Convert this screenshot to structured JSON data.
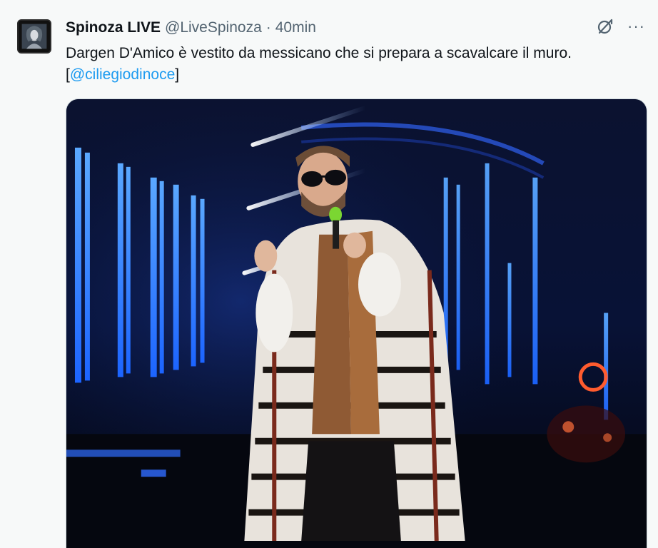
{
  "tweet": {
    "display_name": "Spinoza LIVE",
    "handle": "@LiveSpinoza",
    "separator": "·",
    "time": "40min",
    "text_line1": "Dargen D'Amico è vestito da messicano che si prepara a scavalcare il muro.",
    "text_open_bracket": "[",
    "mention": "@ciliegiodinoce",
    "text_close_bracket": "]",
    "more_label": "···",
    "colors": {
      "link": "#1d9bf0",
      "secondary_text": "#536471",
      "primary_text": "#0f1419",
      "background": "#f7f9f9"
    },
    "icons": [
      "avatar",
      "grok-icon",
      "more-icon"
    ]
  }
}
